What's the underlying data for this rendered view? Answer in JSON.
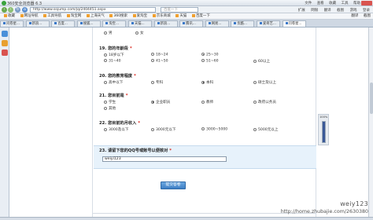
{
  "window": {
    "title": "360安全浏览器 6.3",
    "menus": [
      "文件",
      "查看",
      "收藏",
      "工具",
      "帮助"
    ]
  },
  "address_bar": {
    "url": "http://www.sojump.com/jq/2404451.aspx",
    "search_placeholder": "百度一下",
    "right_items": [
      "扩展",
      "网银",
      "翻译",
      "截图",
      "游戏",
      "登录"
    ]
  },
  "bookmarks": {
    "items": [
      "收藏",
      "网址导航",
      "工具导航",
      "淘宝网",
      "上海天气",
      "360搜索",
      "爱淘宝",
      "京东商城",
      "天猫",
      "百度一下"
    ],
    "right_items": [
      "翻译",
      "截图"
    ]
  },
  "tabs": [
    "问卷星...",
    "新浪...",
    "百度...",
    "搜狐...",
    "淘宝...",
    "天猫...",
    "新浪...",
    "腾讯...",
    "网易...",
    "优酷...",
    "爱奇艺...",
    "问卷星..."
  ],
  "survey": {
    "top_options": [
      "男",
      "女"
    ],
    "questions": [
      {
        "title": "19. 您的年龄段",
        "required": "*",
        "options": [
          "18岁以下",
          "18~24",
          "25~30",
          "31~40",
          "41~50",
          "51~60",
          "60以上"
        ],
        "selected": 2
      },
      {
        "title": "20. 您的教育程度",
        "required": "*",
        "options": [
          "高中以下",
          "专科",
          "本科",
          "硕士及以上"
        ],
        "selected": 2
      },
      {
        "title": "21. 您目前是",
        "required": "*",
        "options": [
          "学生",
          "企业职员",
          "教师",
          "政府公务员",
          "其他"
        ],
        "selected": 1
      },
      {
        "title": "22. 您目前的月收入",
        "required": "*",
        "options": [
          "3000及以下",
          "3000元以下",
          "3000~5000",
          "5000元以上"
        ],
        "selected": -1
      }
    ],
    "final_question": {
      "title": "23. 请留下您的QQ号或账号以便核对",
      "required": "*",
      "value": "weiyi123"
    },
    "submit_label": "提交答卷"
  },
  "side_widget": {
    "percent_label": "100%",
    "progress": 1.0
  },
  "watermark": {
    "name": "weiy123",
    "url": "http://home.zhubajie.com/2630380"
  },
  "colors": {
    "required": "#d9251c",
    "submit": "#3e7fc4",
    "highlight": "#e7f2fb"
  }
}
